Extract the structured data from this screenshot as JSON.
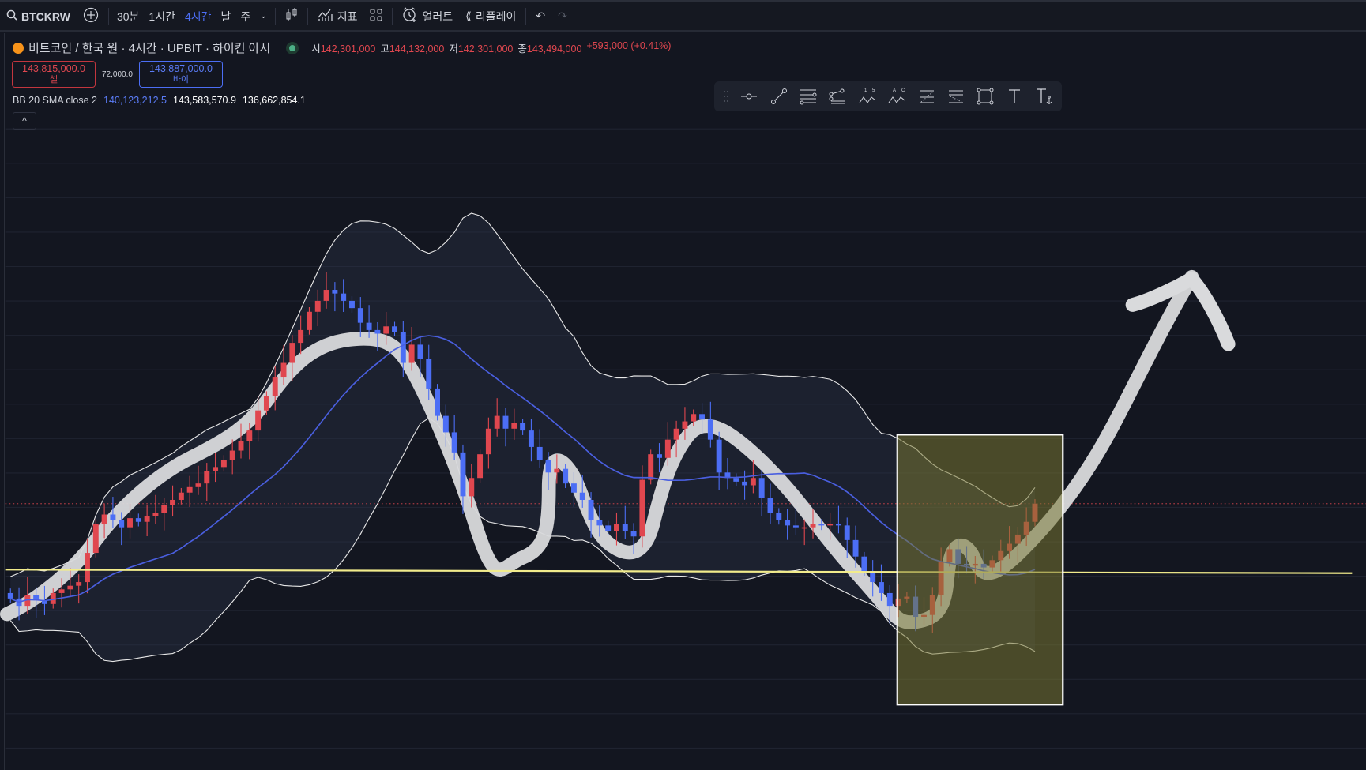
{
  "topbar": {
    "symbol": "BTCKRW",
    "timeframes": [
      "30분",
      "1시간",
      "4시간",
      "날",
      "주"
    ],
    "active_timeframe": "4시간",
    "indicators_label": "지표",
    "alert_label": "얼러트",
    "replay_label": "리플레이"
  },
  "legend": {
    "title": "비트코인 / 한국 원 · 4시간 · UPBIT · 하이킨 아시",
    "open_label": "시",
    "open": "142,301,000",
    "high_label": "고",
    "high": "144,132,000",
    "low_label": "저",
    "low": "142,301,000",
    "close_label": "종",
    "close": "143,494,000",
    "change": "+593,000 (+0.41%)"
  },
  "trade": {
    "sell_price": "143,815,000.0",
    "sell_label": "셀",
    "spread": "72,000.0",
    "buy_price": "143,887,000.0",
    "buy_label": "바이"
  },
  "indicator": {
    "name": "BB 20 SMA close 2",
    "basis": "140,123,212.5",
    "upper": "143,583,570.9",
    "lower": "136,662,854.1"
  },
  "colors": {
    "up": "#e0474f",
    "down": "#4c6ef5",
    "basis": "#4a5fe0",
    "band": "#e8e8e8",
    "hline": "#f2ec8c"
  },
  "chart_data": {
    "type": "candlestick",
    "chart_type": "heikin-ashi",
    "unit": "million KRW",
    "first_open": 138.6,
    "closes": [
      138.3,
      137.9,
      138.5,
      138.2,
      138.0,
      138.6,
      138.8,
      139.0,
      139.2,
      140.8,
      142.4,
      142.9,
      142.6,
      142.2,
      142.7,
      142.5,
      142.8,
      143.0,
      143.4,
      143.7,
      144.1,
      144.4,
      144.6,
      145.3,
      145.5,
      145.9,
      146.4,
      146.9,
      147.5,
      148.6,
      149.4,
      150.4,
      151.2,
      152.3,
      153.0,
      154.0,
      154.6,
      155.2,
      155.0,
      154.6,
      154.2,
      153.4,
      153.0,
      152.8,
      153.2,
      152.9,
      151.2,
      152.2,
      151.4,
      149.8,
      148.3,
      147.4,
      146.3,
      143.9,
      144.9,
      146.2,
      147.6,
      148.3,
      147.6,
      147.9,
      147.5,
      146.6,
      145.9,
      145.2,
      145.4,
      144.6,
      144.1,
      143.7,
      142.6,
      142.3,
      142.0,
      142.4,
      142.0,
      141.7,
      144.8,
      146.2,
      146.0,
      147.0,
      147.6,
      148.0,
      148.4,
      148.1,
      147.0,
      145.2,
      144.9,
      144.7,
      144.5,
      144.9,
      143.8,
      143.0,
      142.6,
      142.3,
      142.2,
      142.2,
      142.4,
      142.3,
      142.4,
      142.3,
      141.5,
      140.6,
      139.8,
      139.2,
      138.6,
      137.9,
      138.3,
      138.4,
      137.3,
      137.4,
      138.5,
      140.3,
      141.0,
      140.2,
      140.1,
      140.2,
      140.0,
      140.4,
      140.9,
      141.3,
      141.8,
      142.5,
      143.49
    ],
    "last_price": 143.494,
    "horizontal_line": 140.0,
    "bollinger": {
      "period": 20,
      "mult": 2,
      "basis": 140.123,
      "upper": 143.584,
      "lower": 136.663
    }
  }
}
